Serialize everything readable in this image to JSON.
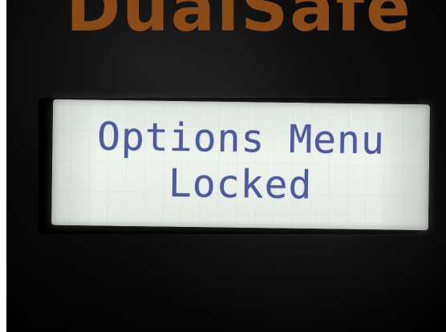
{
  "brand": {
    "text": "DualSafe"
  },
  "display": {
    "line1": "Options Menu",
    "line2": "Locked"
  },
  "colors": {
    "device": "#080808",
    "logo": "#8a4a17",
    "lcd_background": "#e8eee8",
    "lcd_text": "#4d5a9d"
  }
}
